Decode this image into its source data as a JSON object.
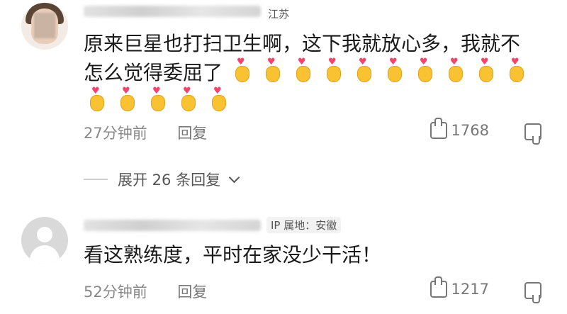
{
  "comments": [
    {
      "location": "江苏",
      "text": "原来巨星也打扫卫生啊，这下我就放心多，我就不怎么觉得委屈了",
      "emoji_count": 15,
      "time": "27分钟前",
      "reply_label": "回复",
      "likes": "1768"
    },
    {
      "location": "IP 属地：安徽",
      "text": "看这熟练度，平时在家没少干活！",
      "time": "52分钟前",
      "reply_label": "回复",
      "likes": "1217"
    }
  ],
  "expand": {
    "label": "展开 26 条回复"
  },
  "icons": {
    "emoji": "heart-hand-emoji",
    "like": "thumbs-up-icon",
    "dislike": "thumbs-down-icon",
    "expand": "chevron-down-icon"
  }
}
